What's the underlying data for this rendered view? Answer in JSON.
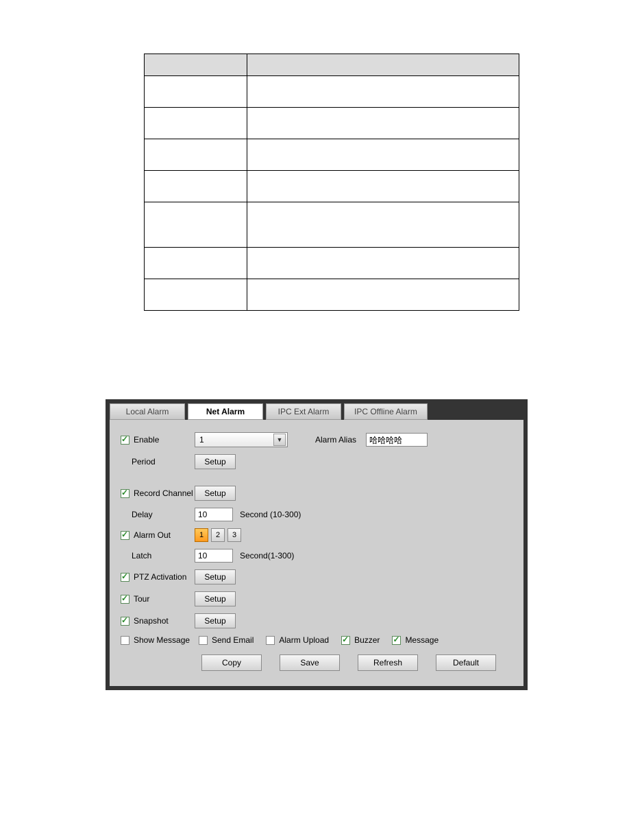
{
  "table": {
    "rows": [
      {
        "param": "",
        "desc": "",
        "header": true
      },
      {
        "param": "",
        "desc": ""
      },
      {
        "param": "",
        "desc": ""
      },
      {
        "param": "",
        "desc": ""
      },
      {
        "param": "",
        "desc": ""
      },
      {
        "param": "",
        "desc": "",
        "tall": true
      },
      {
        "param": "",
        "desc": ""
      },
      {
        "param": "",
        "desc": ""
      }
    ]
  },
  "tabs": {
    "t0": "Local Alarm",
    "t1": "Net Alarm",
    "t2": "IPC Ext Alarm",
    "t3": "IPC Offline Alarm",
    "active": 1
  },
  "fields": {
    "enable": "Enable",
    "channel_value": "1",
    "alarm_alias_lbl": "Alarm Alias",
    "alarm_alias_val": "哈哈哈哈",
    "period": "Period",
    "setup": "Setup",
    "record_channel": "Record Channel",
    "delay": "Delay",
    "delay_val": "10",
    "delay_unit": "Second (10-300)",
    "alarm_out": "Alarm Out",
    "ao1": "1",
    "ao2": "2",
    "ao3": "3",
    "latch": "Latch",
    "latch_val": "10",
    "latch_unit": "Second(1-300)",
    "ptz": "PTZ Activation",
    "tour": "Tour",
    "snapshot": "Snapshot",
    "show_message": "Show Message",
    "send_email": "Send Email",
    "alarm_upload": "Alarm Upload",
    "buzzer": "Buzzer",
    "message": "Message"
  },
  "buttons": {
    "copy": "Copy",
    "save": "Save",
    "refresh": "Refresh",
    "default": "Default"
  }
}
